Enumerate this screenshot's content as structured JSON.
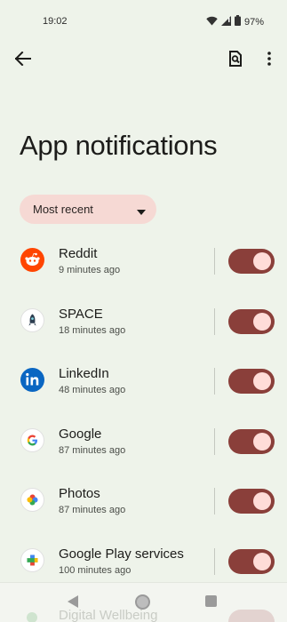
{
  "status": {
    "time": "19:02",
    "battery_pct": "97%"
  },
  "appbar": {
    "back_icon": "arrow-back-icon",
    "search_icon": "search-settings-icon",
    "more_icon": "more-vert-icon"
  },
  "page": {
    "title": "App notifications"
  },
  "sort": {
    "label": "Most recent"
  },
  "apps": [
    {
      "name": "Reddit",
      "time": "9 minutes ago",
      "enabled": true,
      "icon": "reddit-icon",
      "color": "#ff4500"
    },
    {
      "name": "SPACE",
      "time": "18 minutes ago",
      "enabled": true,
      "icon": "space-icon",
      "color": "#ffffff"
    },
    {
      "name": "LinkedIn",
      "time": "48 minutes ago",
      "enabled": true,
      "icon": "linkedin-icon",
      "color": "#0a66c2"
    },
    {
      "name": "Google",
      "time": "87 minutes ago",
      "enabled": true,
      "icon": "google-icon",
      "color": "#ffffff"
    },
    {
      "name": "Photos",
      "time": "87 minutes ago",
      "enabled": true,
      "icon": "photos-icon",
      "color": "#ffffff"
    },
    {
      "name": "Google Play services",
      "time": "100 minutes ago",
      "enabled": true,
      "icon": "play-services-icon",
      "color": "#ffffff"
    }
  ],
  "partial_row": {
    "name": "Digital Wellbeing"
  },
  "colors": {
    "background": "#eef3ea",
    "toggle_track": "#8a3f3a",
    "toggle_thumb": "#ffdcd8",
    "chip": "#f6d9d4"
  }
}
